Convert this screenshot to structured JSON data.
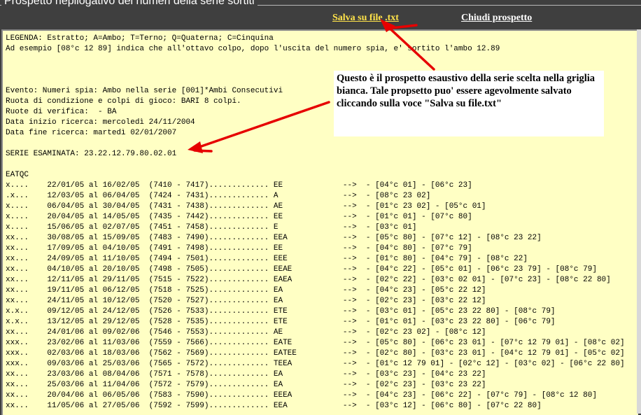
{
  "window": {
    "title": "Prospetto riepilogativo dei numeri della serie sortiti"
  },
  "toolbar": {
    "save_label": "Salva su file .txt",
    "close_label": "Chiudi prospetto"
  },
  "callout": {
    "text": "Questo è il prospetto esaustivo della serie scelta nella griglia bianca. Tale propsetto puo' essere agevolmente salvato cliccando sulla voce \"Salva su file.txt\""
  },
  "report": {
    "header_lines": [
      "LEGENDA: Estratto; A=Ambo; T=Terno; Q=Quaterna; C=Cinquina",
      "Ad esempio [08°c 12 89] indica che all'ottavo colpo, dopo l'uscita del numero spia, e' sortito l'ambo 12.89",
      "",
      "",
      "",
      "Evento: Numeri spia: Ambo nella serie [001]*Ambi Consecutivi",
      "Ruota di condizione e colpi di gioco: BARI 8 colpi.",
      "Ruote di verifica:  - BA",
      "Data inizio ricerca: mercoledì 24/11/2004",
      "Data fine ricerca: martedì 02/01/2007",
      "",
      "SERIE ESAMINATA: 23.22.12.79.80.02.01",
      "",
      "EATQC"
    ],
    "rows": [
      "x....    22/01/05 al 16/02/05  (7410 - 7417)............. EE             -->  - [04°c 01] - [06°c 23]",
      ".x...    12/03/05 al 06/04/05  (7424 - 7431)............. A              -->  - [08°c 23 02]",
      "x....    06/04/05 al 30/04/05  (7431 - 7438)............. AE             -->  - [01°c 23 02] - [05°c 01]",
      "x....    20/04/05 al 14/05/05  (7435 - 7442)............. EE             -->  - [01°c 01] - [07°c 80]",
      "x....    15/06/05 al 02/07/05  (7451 - 7458)............. E              -->  - [03°c 01]",
      "xx...    30/08/05 al 15/09/05  (7483 - 7490)............. EEA            -->  - [05°c 80] - [07°c 12] - [08°c 23 22]",
      "xx...    17/09/05 al 04/10/05  (7491 - 7498)............. EE             -->  - [04°c 80] - [07°c 79]",
      "xx...    24/09/05 al 11/10/05  (7494 - 7501)............. EEE            -->  - [01°c 80] - [04°c 79] - [08°c 22]",
      "xx...    04/10/05 al 20/10/05  (7498 - 7505)............. EEAE           -->  - [04°c 22] - [05°c 01] - [06°c 23 79] - [08°c 79]",
      "xx...    12/11/05 al 29/11/05  (7515 - 7522)............. EAEA           -->  - [02°c 22] - [03°c 02 01] - [07°c 23] - [08°c 22 80]",
      "xx...    19/11/05 al 06/12/05  (7518 - 7525)............. EA             -->  - [04°c 23] - [05°c 22 12]",
      "xx...    24/11/05 al 10/12/05  (7520 - 7527)............. EA             -->  - [02°c 23] - [03°c 22 12]",
      "x.x..    09/12/05 al 24/12/05  (7526 - 7533)............. ETE            -->  - [03°c 01] - [05°c 23 22 80] - [08°c 79]",
      "x.x..    13/12/05 al 29/12/05  (7528 - 7535)............. ETE            -->  - [01°c 01] - [03°c 23 22 80] - [06°c 79]",
      "xx...    24/01/06 al 09/02/06  (7546 - 7553)............. AE             -->  - [02°c 23 02] - [08°c 12]",
      "xxx..    23/02/06 al 11/03/06  (7559 - 7566)............. EATE           -->  - [05°c 80] - [06°c 23 01] - [07°c 12 79 01] - [08°c 02]",
      "xxx..    02/03/06 al 18/03/06  (7562 - 7569)............. EATEE          -->  - [02°c 80] - [03°c 23 01] - [04°c 12 79 01] - [05°c 02]",
      "xxx..    09/03/06 al 25/03/06  (7565 - 7572)............. TEEA           -->  - [01°c 12 79 01] - [02°c 12] - [03°c 02] - [06°c 22 80]",
      "xx...    23/03/06 al 08/04/06  (7571 - 7578)............. EA             -->  - [03°c 23] - [04°c 23 22]",
      "xx...    25/03/06 al 11/04/06  (7572 - 7579)............. EA             -->  - [02°c 23] - [03°c 23 22]",
      "xx...    20/04/06 al 06/05/06  (7583 - 7590)............. EEEA           -->  - [04°c 23] - [06°c 22] - [07°c 79] - [08°c 12 80]",
      "xx...    11/05/06 al 27/05/06  (7592 - 7599)............. EEA            -->  - [03°c 12] - [06°c 80] - [07°c 22 80]"
    ]
  },
  "colors": {
    "title_bar": "#3f3f3f",
    "report_bg": "#ffffc4",
    "save_link": "#ffe34a",
    "close_link": "#ffffff",
    "annotation_arrow": "#e60000"
  }
}
